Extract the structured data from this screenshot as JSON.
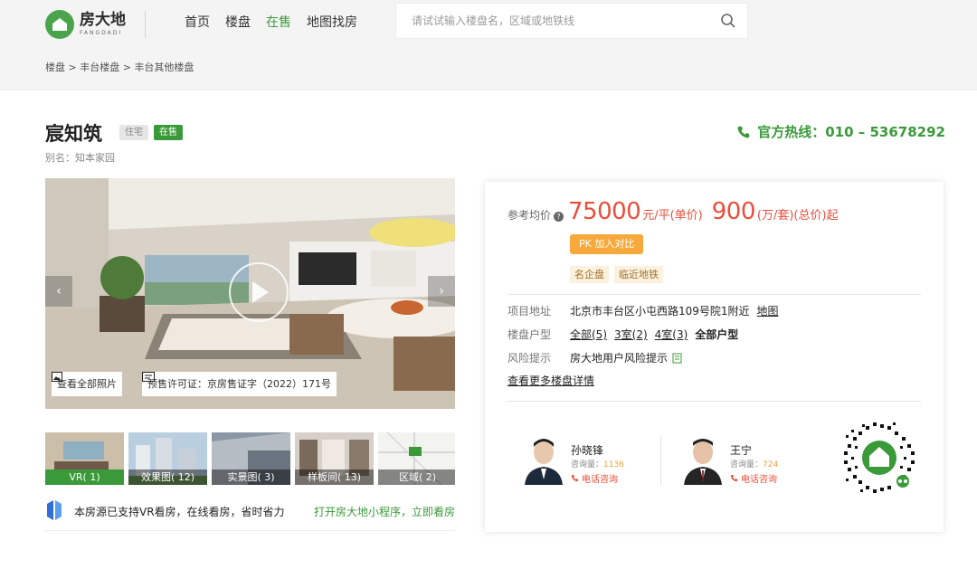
{
  "brand": {
    "name_cn": "房大地",
    "name_en": "FANGDADI",
    "color": "#3a9a3a"
  },
  "nav": [
    {
      "label": "首页"
    },
    {
      "label": "楼盘"
    },
    {
      "label": "在售",
      "active": true
    },
    {
      "label": "地图找房"
    }
  ],
  "search": {
    "placeholder": "请试试输入楼盘名，区域或地铁线"
  },
  "breadcrumb": [
    "楼盘",
    "丰台楼盘",
    "丰台其他楼盘"
  ],
  "property": {
    "name": "宸知筑",
    "type_badge": "住宅",
    "status_badge": "在售",
    "alias": "别名：知本家园"
  },
  "hotline": "官方热线：010 – 53678292",
  "gallery": {
    "view_all": "查看全部照片",
    "license": "预售许可证：京房售证字（2022）171号",
    "thumbs": [
      {
        "label": "VR( 1)",
        "active": true
      },
      {
        "label": "效果图( 12)"
      },
      {
        "label": "实景图( 3)"
      },
      {
        "label": "样板间( 13)"
      },
      {
        "label": "区域( 2)"
      }
    ]
  },
  "vr_banner": {
    "message": "本房源已支持VR看房，在线看房，省时省力",
    "link": "打开房大地小程序，立即看房"
  },
  "price": {
    "label": "参考均价",
    "q": "?",
    "unit_price": "75000",
    "unit_price_unit": "元/平(单价)",
    "total_price": "900",
    "total_price_unit": "(万/套)(总价)起",
    "pk_button": "PK 加入对比",
    "tags": [
      "名企盘",
      "临近地铁"
    ]
  },
  "details": {
    "address_label": "项目地址",
    "address": "北京市丰台区小屯西路109号院1附近",
    "map_link": "地图",
    "layout_label": "楼盘户型",
    "layouts": [
      "全部(5)",
      "3室(2)",
      "4室(3)"
    ],
    "all_layouts": "全部户型",
    "risk_label": "风险提示",
    "risk": "房大地用户风险提示",
    "more_link": "查看更多楼盘详情"
  },
  "agents": [
    {
      "name": "孙晓锋",
      "count_label": "咨询量：",
      "count": "1136",
      "call": "电话咨询"
    },
    {
      "name": "王宁",
      "count_label": "咨询量：",
      "count": "724",
      "call": "电话咨询"
    }
  ],
  "colors": {
    "price": "#e84f3c",
    "accent": "#3a9a3a",
    "orange": "#f7a93b"
  }
}
